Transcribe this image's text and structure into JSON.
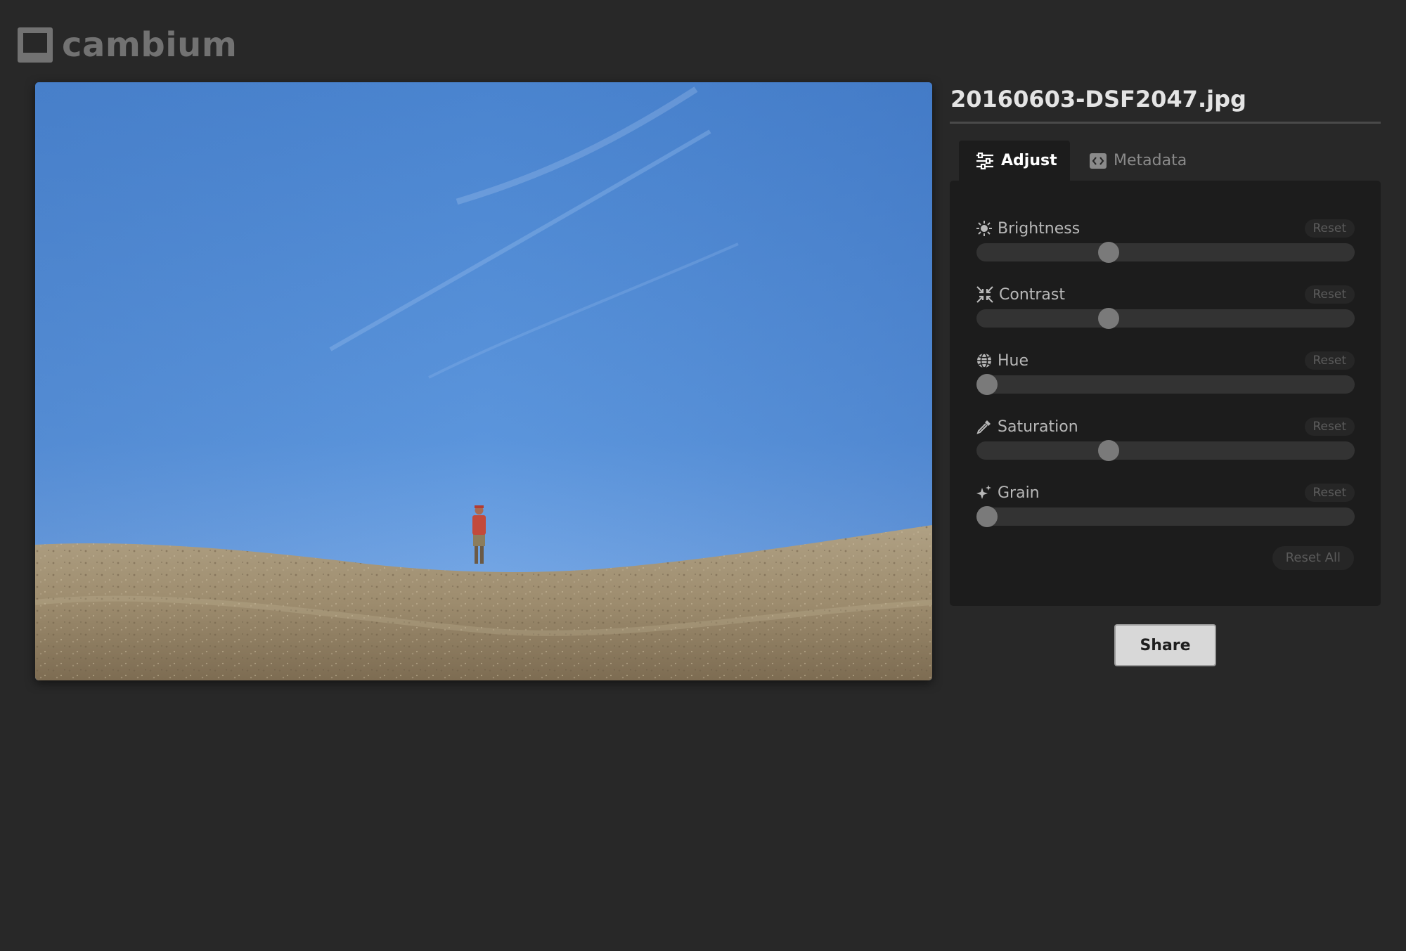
{
  "app": {
    "name": "cambium"
  },
  "image": {
    "filename": "20160603-DSF2047.jpg"
  },
  "tabs": [
    {
      "label": "Adjust",
      "icon": "sliders-icon",
      "active": true
    },
    {
      "label": "Metadata",
      "icon": "code-icon",
      "active": false
    }
  ],
  "adjustments": [
    {
      "label": "Brightness",
      "icon": "sun-icon",
      "reset_label": "Reset",
      "value": 0.34
    },
    {
      "label": "Contrast",
      "icon": "compress-icon",
      "reset_label": "Reset",
      "value": 0.34
    },
    {
      "label": "Hue",
      "icon": "globe-icon",
      "reset_label": "Reset",
      "value": 0.0
    },
    {
      "label": "Saturation",
      "icon": "eyedropper-icon",
      "reset_label": "Reset",
      "value": 0.34
    },
    {
      "label": "Grain",
      "icon": "sparkles-icon",
      "reset_label": "Reset",
      "value": 0.0
    }
  ],
  "reset_all_label": "Reset All",
  "share_label": "Share",
  "colors": {
    "background": "#282828",
    "panel": "#1c1c1c",
    "track": "#333333",
    "thumb": "#7a7a7a",
    "sky": "#4d8ad4",
    "ground": "#a08f72"
  }
}
